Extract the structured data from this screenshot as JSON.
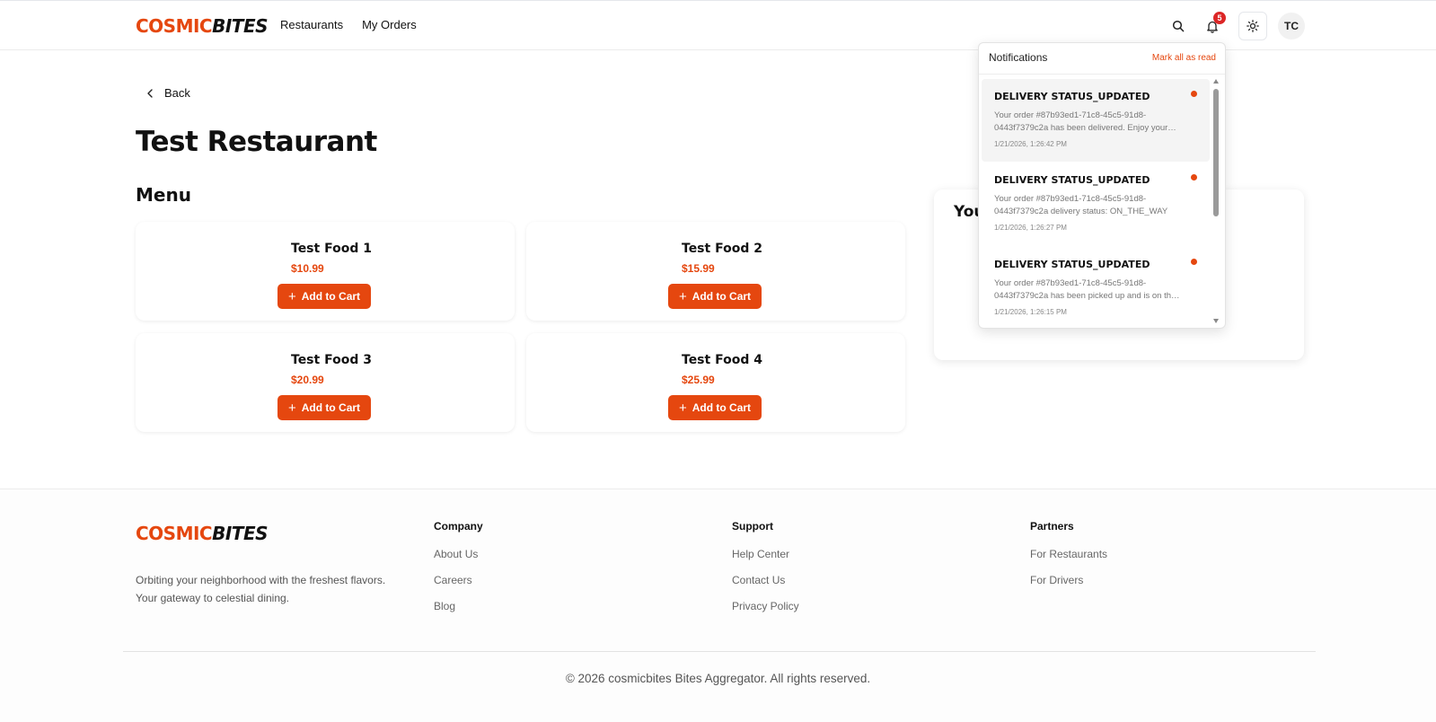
{
  "header": {
    "logo_primary": "COSMIC",
    "logo_secondary": "BITES",
    "nav": [
      "Restaurants",
      "My Orders"
    ],
    "notification_count": "5",
    "avatar_initials": "TC"
  },
  "main": {
    "back_label": "Back",
    "restaurant_name": "Test Restaurant",
    "menu_title": "Menu",
    "add_label": "Add to Cart",
    "items": [
      {
        "name": "Test Food 1",
        "price": "$10.99"
      },
      {
        "name": "Test Food 2",
        "price": "$15.99"
      },
      {
        "name": "Test Food 3",
        "price": "$20.99"
      },
      {
        "name": "Test Food 4",
        "price": "$25.99"
      }
    ],
    "cart_title_visible": "You"
  },
  "notifications": {
    "title": "Notifications",
    "mark_all": "Mark all as read",
    "items": [
      {
        "title": "DELIVERY STATUS_UPDATED",
        "line1": "Your order #87b93ed1-71c8-45c5-91d8-",
        "line2": "0443f7379c2a has been delivered. Enjoy your…",
        "time": "1/21/2026, 1:26:42 PM"
      },
      {
        "title": "DELIVERY STATUS_UPDATED",
        "line1": "Your order #87b93ed1-71c8-45c5-91d8-",
        "line2": "0443f7379c2a delivery status: ON_THE_WAY",
        "time": "1/21/2026, 1:26:27 PM"
      },
      {
        "title": "DELIVERY STATUS_UPDATED",
        "line1": "Your order #87b93ed1-71c8-45c5-91d8-",
        "line2": "0443f7379c2a has been picked up and is on th…",
        "time": "1/21/2026, 1:26:15 PM"
      }
    ]
  },
  "footer": {
    "logo_primary": "COSMIC",
    "logo_secondary": "BITES",
    "tagline_1": "Orbiting your neighborhood with the freshest flavors.",
    "tagline_2": "Your gateway to celestial dining.",
    "company": {
      "heading": "Company",
      "links": [
        "About Us",
        "Careers",
        "Blog"
      ]
    },
    "support": {
      "heading": "Support",
      "links": [
        "Help Center",
        "Contact Us",
        "Privacy Policy"
      ]
    },
    "partners": {
      "heading": "Partners",
      "links": [
        "For Restaurants",
        "For Drivers"
      ]
    },
    "copyright": "© 2026 cosmicbites Bites Aggregator. All rights reserved."
  },
  "colors": {
    "accent": "#e5470f",
    "badge": "#dc2626"
  }
}
